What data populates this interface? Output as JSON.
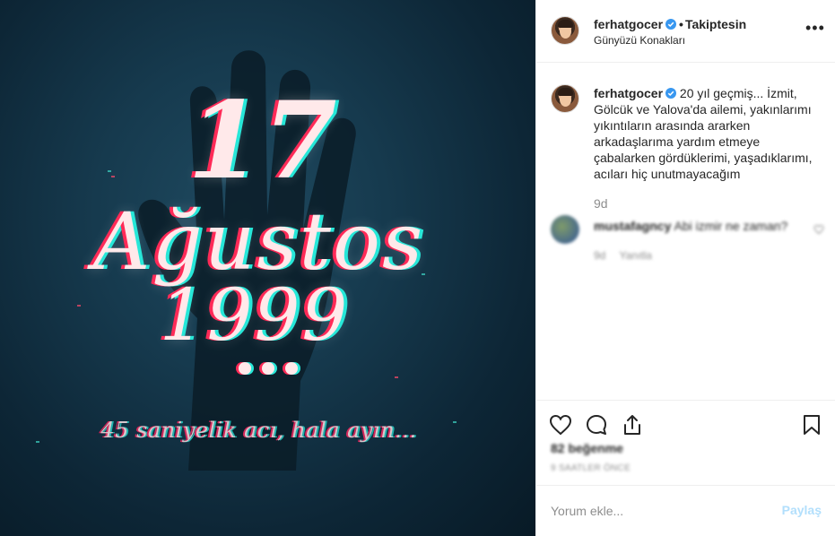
{
  "image": {
    "day": "17",
    "month": "Ağustos",
    "year": "1999",
    "subtitle": "45 saniyelik acı, hala ayın..."
  },
  "header": {
    "username": "ferhatgocer",
    "separator": "•",
    "follow_status": "Takiptesin",
    "location": "Günyüzü Konakları",
    "more_icon": "ellipsis-icon"
  },
  "caption": {
    "username": "ferhatgocer",
    "text": "20 yıl geçmiş... İzmit, Gölcük ve Yalova'da ailemi, yakınlarımı yıkıntıların arasında ararken arkadaşlarıma yardım etmeye çabalarken gördüklerimi, yaşadıklarımı, acıları hiç unutmayacağım",
    "time": "9d"
  },
  "comment": {
    "username": "mustafagncy",
    "text": "Abi izmir ne zaman?",
    "time": "9d",
    "reply_label": "Yanıtla"
  },
  "actions": {
    "like_icon": "heart-icon",
    "comment_icon": "comment-icon",
    "share_icon": "share-icon",
    "save_icon": "bookmark-icon",
    "likes": "82 beğenme",
    "posted": "9 SAATLER ÖNCE"
  },
  "comment_box": {
    "placeholder": "Yorum ekle...",
    "post_label": "Paylaş"
  },
  "colors": {
    "verified": "#3897f0",
    "link_disabled": "#b2dffc",
    "secondary_text": "#8e8e8e",
    "glitch_red": "#ff2a57",
    "glitch_cyan": "#27e7d8"
  }
}
